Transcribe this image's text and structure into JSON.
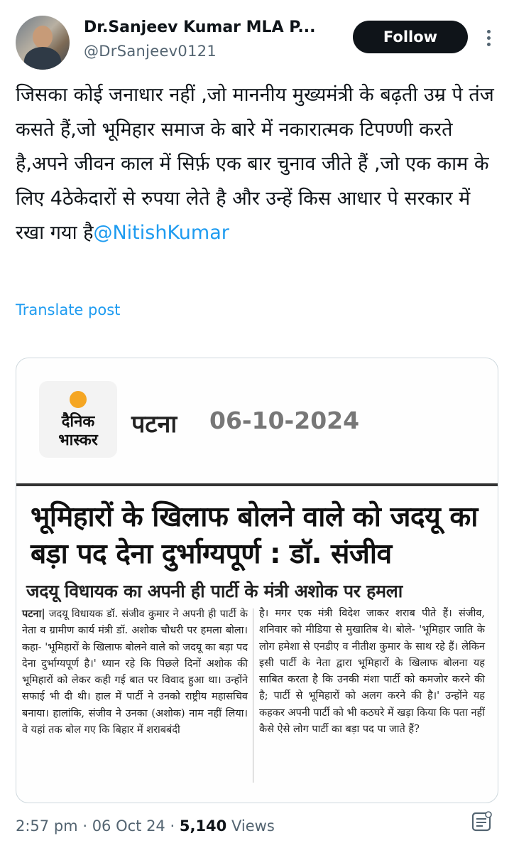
{
  "author": {
    "name": "Dr.Sanjeev Kumar MLA P...",
    "handle": "@DrSanjeev0121"
  },
  "actions": {
    "follow_label": "Follow",
    "more_icon": "more-dots-icon"
  },
  "tweet": {
    "text": "जिसका कोई जनाधार नहीं ,जो माननीय मुख्यमंत्री के बढ़ती उम्र पे तंज कसते हैं,जो भूमिहार समाज के बारे में नकारात्मक टिपण्णी करते है,अपने जीवन काल में सिर्फ़ एक बार चुनाव जीते हैं ,जो एक काम के लिए 4ठेकेदारों से रुपया लेते है और उन्हें किस आधार पे सरकार में रखा गया है",
    "mention": "@NitishKumar",
    "translate_label": "Translate post"
  },
  "media": {
    "logo_line1": "दैनिक",
    "logo_line2": "भास्कर",
    "city": "पटना",
    "date": "06-10-2024",
    "headline": "भूमिहारों के खिलाफ बोलने वाले को जदयू का बड़ा पद देना दुर्भाग्यपूर्ण : डॉ. संजीव",
    "subhead": "जदयू विधायक का अपनी ही पार्टी के मंत्री अशोक पर हमला",
    "col_left_lead": "पटना|",
    "col_left": "जदयू विधायक डॉ. संजीव कुमार ने अपनी ही पार्टी के नेता व ग्रामीण कार्य मंत्री डॉ. अशोक चौधरी पर हमला बोला। कहा- 'भूमिहारों के खिलाफ बोलने वाले को जदयू का बड़ा पद देना दुर्भाग्यपूर्ण है।' ध्यान रहे कि पिछले दिनों अशोक की भूमिहारों को लेकर कही गई बात पर विवाद हुआ था। उन्होंने सफाई भी दी थी। हाल में पार्टी ने उनको राष्ट्रीय महासचिव बनाया। हालांकि, संजीव ने उनका (अशोक) नाम नहीं लिया। वे यहां तक बोल गए कि बिहार में शराबबंदी",
    "col_right": "है। मगर एक मंत्री विदेश जाकर शराब पीते हैं। संजीव, शनिवार को मीडिया से मुखातिब थे। बोले- 'भूमिहार जाति के लोग हमेशा से एनडीए व नीतीश कुमार के साथ रहे हैं। लेकिन इसी पार्टी के नेता द्वारा भूमिहारों के खिलाफ बोलना यह साबित करता है कि उनकी मंशा पार्टी को कमजोर करने की है; पार्टी से भूमिहारों को अलग करने की है।' उन्होंने यह कहकर अपनी पार्टी को भी कठघरे में खड़ा किया कि पता नहीं कैसे ऐसे लोग पार्टी का बड़ा पद पा जाते हैं?"
  },
  "footer": {
    "time": "2:57 pm",
    "sep": "·",
    "date": "06 Oct 24",
    "views_count": "5,140",
    "views_label": "Views",
    "grok_icon": "grok-icon"
  }
}
